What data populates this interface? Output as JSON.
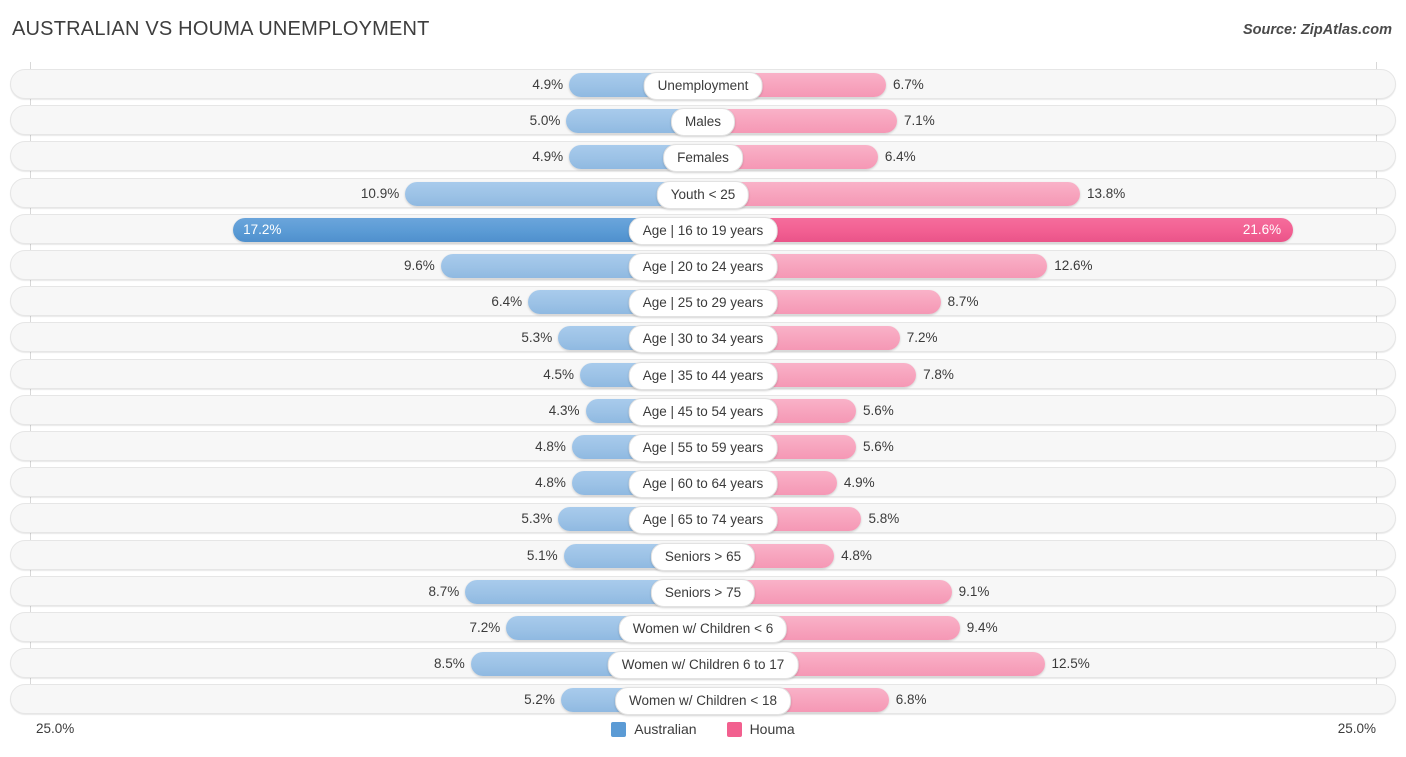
{
  "header": {
    "title": "AUSTRALIAN VS HOUMA UNEMPLOYMENT",
    "source": "Source: ZipAtlas.com"
  },
  "axis": {
    "left_label": "25.0%",
    "right_label": "25.0%"
  },
  "legend": {
    "items": [
      {
        "label": "Australian",
        "color": "#5b9bd5"
      },
      {
        "label": "Houma",
        "color": "#f2608f"
      }
    ]
  },
  "colors": {
    "australian_normal": "#9cc2e6",
    "australian_highlight": "#5b9bd5",
    "houma_normal": "#f7a3bd",
    "houma_highlight": "#f2608f",
    "row_track": "#f7f7f7"
  },
  "chart_data": {
    "type": "bar",
    "subtype": "diverging-bidirectional",
    "title": "AUSTRALIAN VS HOUMA UNEMPLOYMENT",
    "xlabel": "",
    "ylabel": "",
    "unit": "%",
    "axis_max": 25.0,
    "grid": true,
    "legend_position": "bottom-center",
    "categories": [
      "Unemployment",
      "Males",
      "Females",
      "Youth < 25",
      "Age | 16 to 19 years",
      "Age | 20 to 24 years",
      "Age | 25 to 29 years",
      "Age | 30 to 34 years",
      "Age | 35 to 44 years",
      "Age | 45 to 54 years",
      "Age | 55 to 59 years",
      "Age | 60 to 64 years",
      "Age | 65 to 74 years",
      "Seniors > 65",
      "Seniors > 75",
      "Women w/ Children < 6",
      "Women w/ Children 6 to 17",
      "Women w/ Children < 18"
    ],
    "series": [
      {
        "name": "Australian",
        "direction": "left",
        "color": "#9cc2e6",
        "values": [
          4.9,
          5.0,
          4.9,
          10.9,
          17.2,
          9.6,
          6.4,
          5.3,
          4.5,
          4.3,
          4.8,
          4.8,
          5.3,
          5.1,
          8.7,
          7.2,
          8.5,
          5.2
        ]
      },
      {
        "name": "Houma",
        "direction": "right",
        "color": "#f7a3bd",
        "values": [
          6.7,
          7.1,
          6.4,
          13.8,
          21.6,
          12.6,
          8.7,
          7.2,
          7.8,
          5.6,
          5.6,
          4.9,
          5.8,
          4.8,
          9.1,
          9.4,
          12.5,
          6.8
        ]
      }
    ]
  },
  "rows": [
    {
      "label": "Unemployment",
      "left_value": "4.9%",
      "right_value": "6.7%",
      "left_num": 4.9,
      "right_num": 6.7,
      "highlight": false
    },
    {
      "label": "Males",
      "left_value": "5.0%",
      "right_value": "7.1%",
      "left_num": 5.0,
      "right_num": 7.1,
      "highlight": false
    },
    {
      "label": "Females",
      "left_value": "4.9%",
      "right_value": "6.4%",
      "left_num": 4.9,
      "right_num": 6.4,
      "highlight": false
    },
    {
      "label": "Youth < 25",
      "left_value": "10.9%",
      "right_value": "13.8%",
      "left_num": 10.9,
      "right_num": 13.8,
      "highlight": false
    },
    {
      "label": "Age | 16 to 19 years",
      "left_value": "17.2%",
      "right_value": "21.6%",
      "left_num": 17.2,
      "right_num": 21.6,
      "highlight": true
    },
    {
      "label": "Age | 20 to 24 years",
      "left_value": "9.6%",
      "right_value": "12.6%",
      "left_num": 9.6,
      "right_num": 12.6,
      "highlight": false
    },
    {
      "label": "Age | 25 to 29 years",
      "left_value": "6.4%",
      "right_value": "8.7%",
      "left_num": 6.4,
      "right_num": 8.7,
      "highlight": false
    },
    {
      "label": "Age | 30 to 34 years",
      "left_value": "5.3%",
      "right_value": "7.2%",
      "left_num": 5.3,
      "right_num": 7.2,
      "highlight": false
    },
    {
      "label": "Age | 35 to 44 years",
      "left_value": "4.5%",
      "right_value": "7.8%",
      "left_num": 4.5,
      "right_num": 7.8,
      "highlight": false
    },
    {
      "label": "Age | 45 to 54 years",
      "left_value": "4.3%",
      "right_value": "5.6%",
      "left_num": 4.3,
      "right_num": 5.6,
      "highlight": false
    },
    {
      "label": "Age | 55 to 59 years",
      "left_value": "4.8%",
      "right_value": "5.6%",
      "left_num": 4.8,
      "right_num": 5.6,
      "highlight": false
    },
    {
      "label": "Age | 60 to 64 years",
      "left_value": "4.8%",
      "right_value": "4.9%",
      "left_num": 4.8,
      "right_num": 4.9,
      "highlight": false
    },
    {
      "label": "Age | 65 to 74 years",
      "left_value": "5.3%",
      "right_value": "5.8%",
      "left_num": 5.3,
      "right_num": 5.8,
      "highlight": false
    },
    {
      "label": "Seniors > 65",
      "left_value": "5.1%",
      "right_value": "4.8%",
      "left_num": 5.1,
      "right_num": 4.8,
      "highlight": false
    },
    {
      "label": "Seniors > 75",
      "left_value": "8.7%",
      "right_value": "9.1%",
      "left_num": 8.7,
      "right_num": 9.1,
      "highlight": false
    },
    {
      "label": "Women w/ Children < 6",
      "left_value": "7.2%",
      "right_value": "9.4%",
      "left_num": 7.2,
      "right_num": 9.4,
      "highlight": false
    },
    {
      "label": "Women w/ Children 6 to 17",
      "left_value": "8.5%",
      "right_value": "12.5%",
      "left_num": 8.5,
      "right_num": 12.5,
      "highlight": false
    },
    {
      "label": "Women w/ Children < 18",
      "left_value": "5.2%",
      "right_value": "6.8%",
      "left_num": 5.2,
      "right_num": 6.8,
      "highlight": false
    }
  ]
}
